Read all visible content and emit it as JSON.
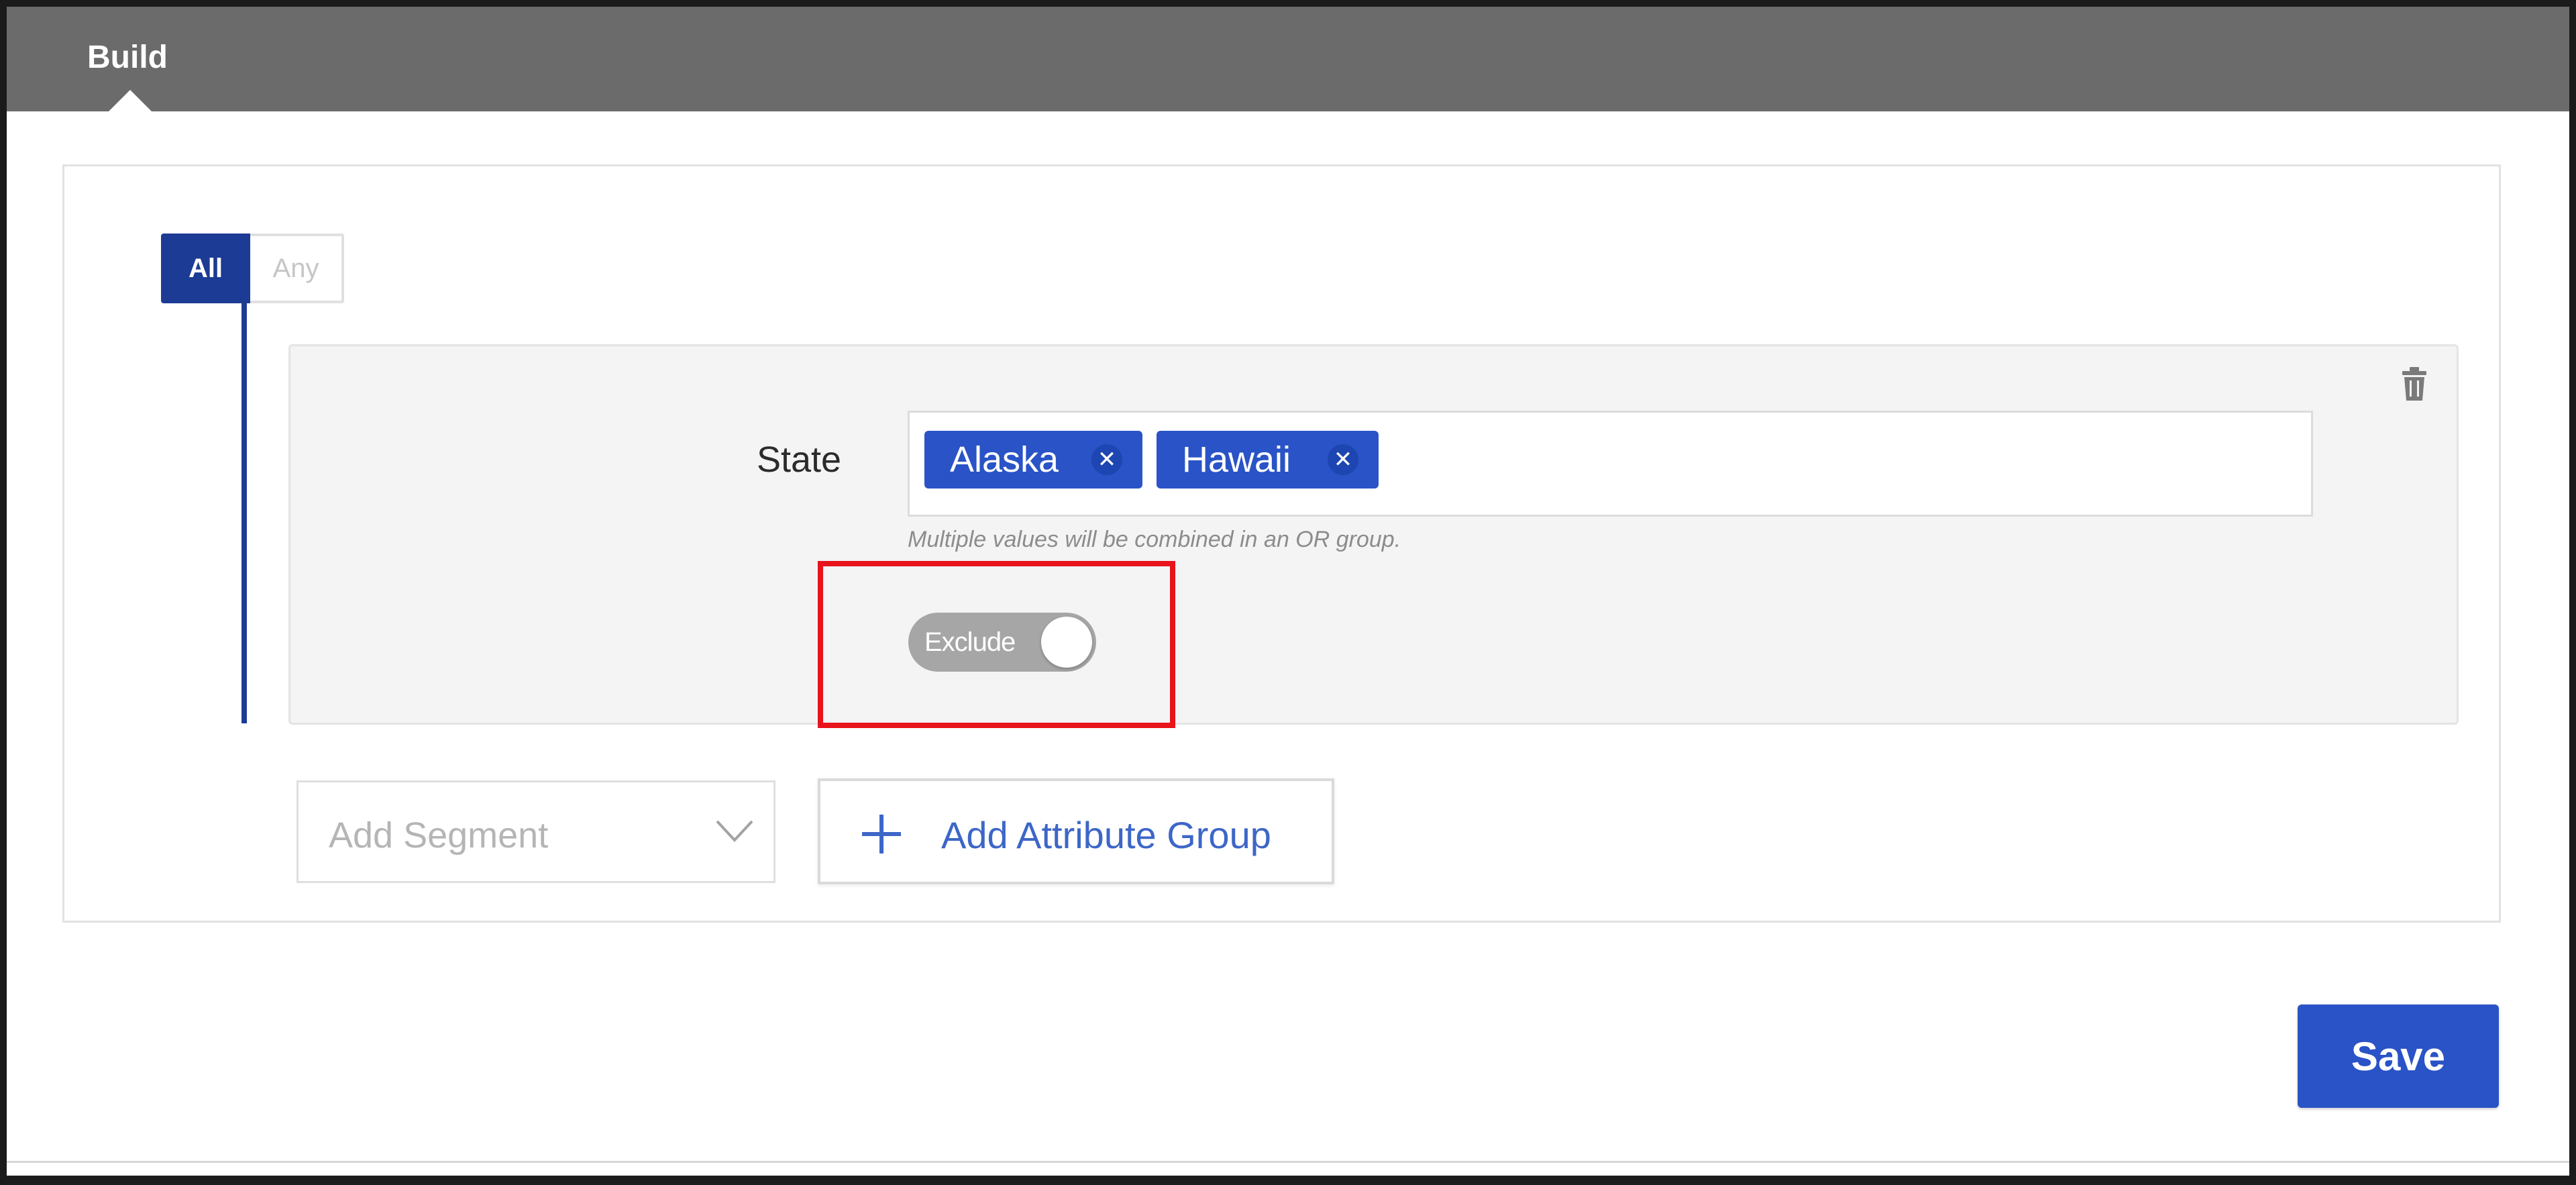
{
  "header": {
    "tab_label": "Build"
  },
  "builder": {
    "logic": {
      "options": [
        "All",
        "Any"
      ],
      "selected": "All"
    },
    "condition": {
      "field_label": "State",
      "values": [
        {
          "label": "Alaska",
          "remove_glyph": "✕"
        },
        {
          "label": "Hawaii",
          "remove_glyph": "✕"
        }
      ],
      "hint": "Multiple values will be combined in an OR group.",
      "exclude": {
        "label": "Exclude",
        "on": false
      }
    },
    "add_segment": {
      "placeholder": "Add Segment"
    },
    "add_attribute_group": {
      "label": "Add Attribute Group"
    }
  },
  "footer": {
    "save_label": "Save"
  },
  "colors": {
    "header_bg": "#6b6b6b",
    "logic_selected": "#1c3b94",
    "chip_bg": "#2953c6",
    "link_blue": "#3d66c8",
    "highlight_red": "#e8131b",
    "toggle_off": "#a6a6a6"
  },
  "icons": {
    "trash": "trash-icon",
    "plus": "plus-icon",
    "chevron": "chevron-down-icon",
    "chip_remove": "close-icon"
  }
}
